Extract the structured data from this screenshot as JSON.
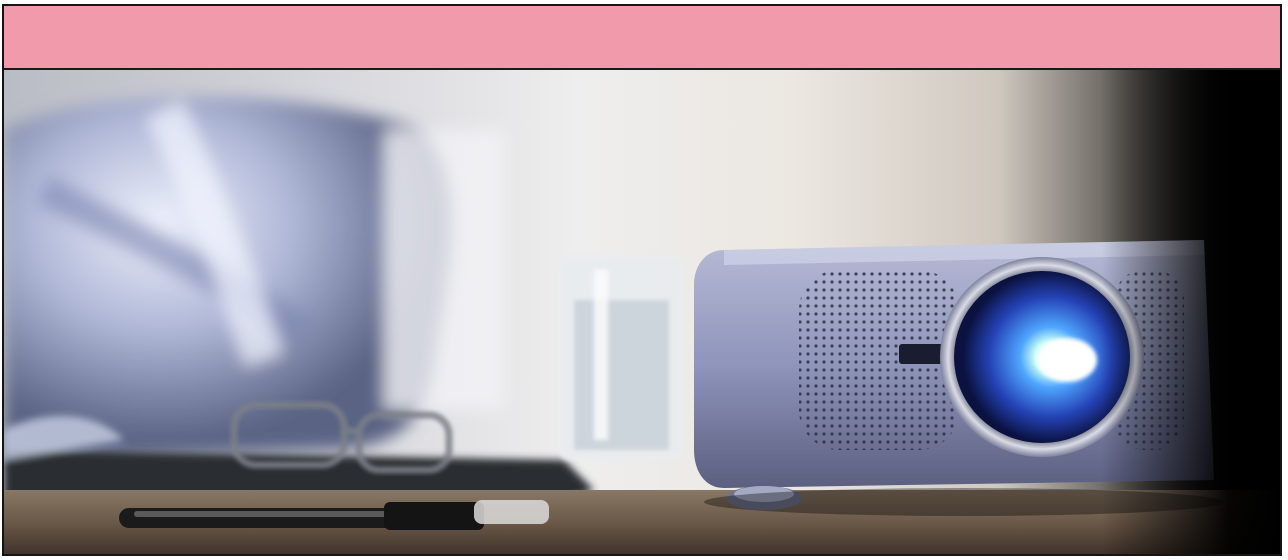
{
  "header": {
    "band_color": "#f19aac"
  },
  "hero": {
    "subject": "projector-photo",
    "colors": {
      "projector_body": "#8a8fb0",
      "lens_glow": "#3a6ee8",
      "desk": "#6b5a4a"
    }
  }
}
